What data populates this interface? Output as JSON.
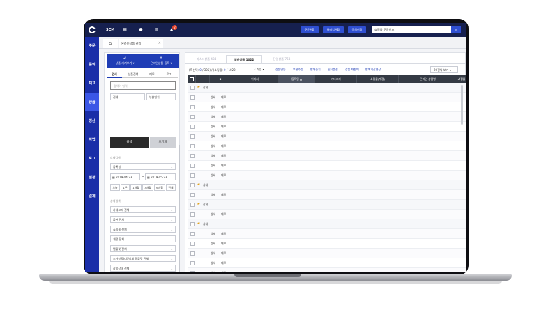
{
  "topbar": {
    "brand": "SCM",
    "notification_count": "2",
    "buttons": [
      "주문현황",
      "클레임현황",
      "문의현황"
    ],
    "search_placeholder": "쇼핑몰 주문번호"
  },
  "leftnav": {
    "items": [
      {
        "label": "주문",
        "active": false
      },
      {
        "label": "문의",
        "active": false
      },
      {
        "label": "재고",
        "active": false
      },
      {
        "label": "상품",
        "active": true
      },
      {
        "label": "정산",
        "active": false
      },
      {
        "label": "작업",
        "active": false
      },
      {
        "label": "로그",
        "active": false
      },
      {
        "label": "설정",
        "active": false
      },
      {
        "label": "결제",
        "active": false
      }
    ]
  },
  "tabs": {
    "page_tab_label": "온라인상품 관리",
    "close_symbol": "×"
  },
  "panel": {
    "import_button": "상품 가져오기",
    "register_button": "온라인상품 등록",
    "tabs": [
      "검색",
      "상품검색",
      "메모",
      "로그"
    ],
    "search_placeholder": "검색어 입력",
    "filter_all": "전체",
    "filter_match": "부분일치",
    "search_button": "검색",
    "reset_button": "초기화",
    "detail_search_label": "상세검색",
    "date_type": "등록일",
    "date_from": "2019-04-23",
    "date_sep": "~",
    "date_to": "2019-05-23",
    "quick_ranges": [
      "오늘",
      "1주",
      "1개월",
      "3개월",
      "6개월",
      "전체"
    ],
    "detail_search_label2": "상세검색",
    "filters": [
      "카테고리 전체",
      "옵션 전체",
      "쇼핑몰 전체",
      "계정 전체",
      "템플릿 전체",
      "추가항목(대)/상세 템플릿 전체",
      "상품상태 전체",
      "배송처 전체",
      "옵션 정책"
    ]
  },
  "main": {
    "tabs": [
      {
        "label": "마스터상품 484",
        "active": false
      },
      {
        "label": "일반상품 1022",
        "active": true
      },
      {
        "label": "단일상품 763",
        "active": false
      }
    ],
    "info_prefix": "(혹선택:",
    "info_selected": "0",
    "info_mid": "/ 305) / (쇼핑몰:",
    "info_shop": "0",
    "info_suffix": "/ 1022)",
    "actions": [
      "작업",
      "상품연동",
      "부분수정",
      "판매중지",
      "일시품절",
      "상품 재판매",
      "판매기간연장"
    ],
    "page_size": "20건씩 보기",
    "columns": [
      "",
      "",
      "",
      "이미지",
      "등록일",
      "카테고리",
      "쇼핑몰(계정)",
      "온라인 상품명",
      "쇼핑몰"
    ],
    "sort_indicator": "▲",
    "rows": [
      {
        "type": "group",
        "label": "상세"
      },
      {
        "type": "item",
        "c1": "상세",
        "c2": "메모"
      },
      {
        "type": "item",
        "c1": "상세",
        "c2": "메모"
      },
      {
        "type": "item",
        "c1": "상세",
        "c2": "메모"
      },
      {
        "type": "item",
        "c1": "상세",
        "c2": "메모"
      },
      {
        "type": "item",
        "c1": "상세",
        "c2": "메모"
      },
      {
        "type": "item",
        "c1": "상세",
        "c2": "메모"
      },
      {
        "type": "item",
        "c1": "상세",
        "c2": "메모"
      },
      {
        "type": "item",
        "c1": "상세",
        "c2": "메모"
      },
      {
        "type": "item",
        "c1": "상세",
        "c2": "메모"
      },
      {
        "type": "group",
        "label": "상세"
      },
      {
        "type": "item",
        "c1": "상세",
        "c2": "메모"
      },
      {
        "type": "group",
        "label": "상세"
      },
      {
        "type": "item",
        "c1": "상세",
        "c2": "메모"
      },
      {
        "type": "group",
        "label": "상세"
      },
      {
        "type": "item",
        "c1": "상세",
        "c2": "메모"
      },
      {
        "type": "item",
        "c1": "상세",
        "c2": "메모"
      },
      {
        "type": "item",
        "c1": "상세",
        "c2": "메모"
      },
      {
        "type": "item",
        "c1": "상세",
        "c2": "메모"
      },
      {
        "type": "item",
        "c1": "상세",
        "c2": "메모"
      }
    ]
  },
  "icons": {
    "logo": "brand-logo-icon",
    "grid": "grid-icon",
    "help": "help-icon",
    "db": "database-icon",
    "bell": "bell-icon",
    "home": "home-icon",
    "folder": "folder-icon",
    "gear": "gear-icon"
  },
  "colors": {
    "topbar": "#16204f",
    "leftnav": "#1a2ea8",
    "leftnav_active": "#3b57e6",
    "accent": "#2f4fd1",
    "table_header": "#343a44"
  }
}
